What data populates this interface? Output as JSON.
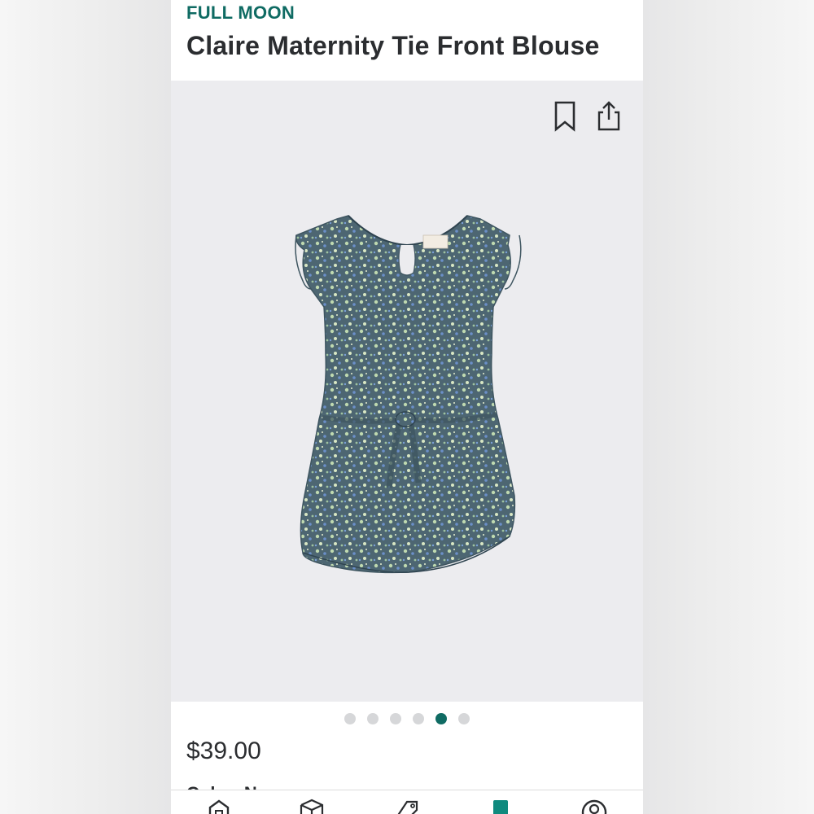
{
  "product": {
    "brand": "FULL MOON",
    "title": "Claire Maternity Tie Front Blouse",
    "price": "$39.00",
    "next_section_peek": "Color: N"
  },
  "gallery": {
    "image_count": 6,
    "active_index": 4,
    "actions": [
      {
        "name": "bookmark-icon"
      },
      {
        "name": "share-icon"
      }
    ]
  },
  "tabbar": {
    "tabs": [
      {
        "icon": "home-icon"
      },
      {
        "icon": "box-icon"
      },
      {
        "icon": "tag-icon"
      },
      {
        "icon": "style-card-icon",
        "active": true
      },
      {
        "icon": "account-icon"
      }
    ]
  },
  "colors": {
    "brand_teal": "#0f6b63",
    "text_dark": "#2b2d30",
    "gallery_bg": "#ececef",
    "dot_inactive": "#d6d7d9"
  }
}
